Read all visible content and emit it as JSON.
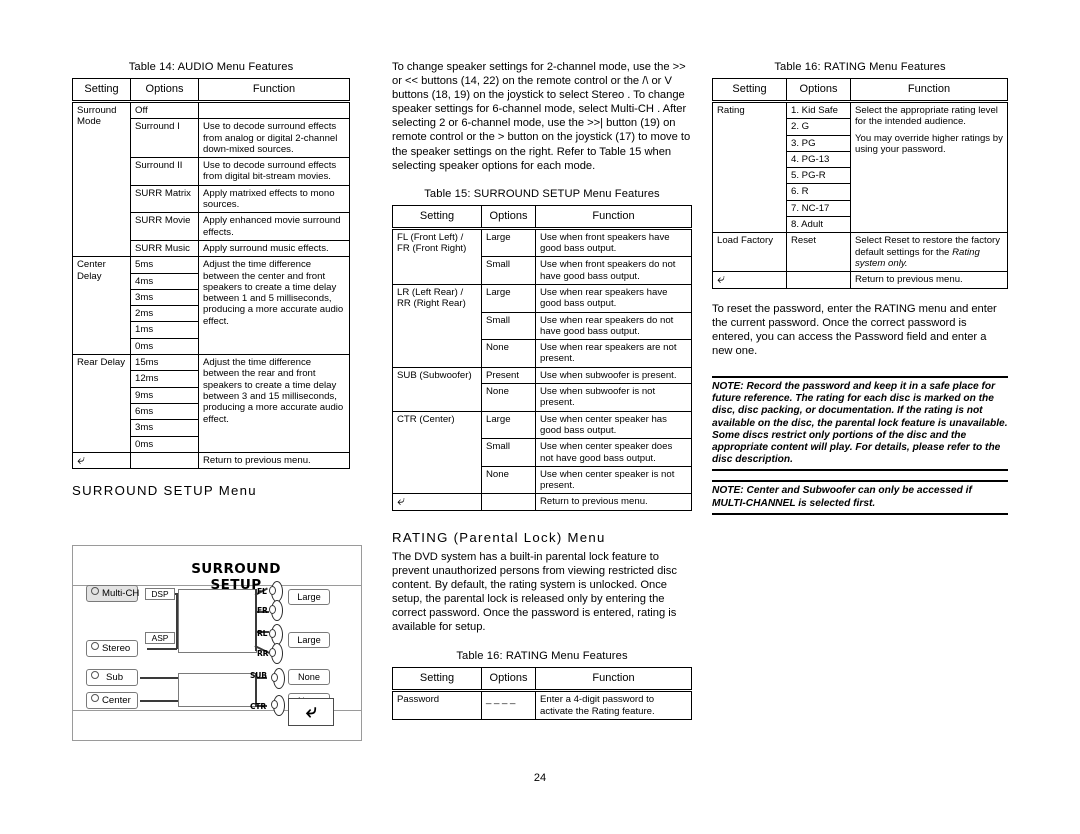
{
  "page": {
    "folio": "24"
  },
  "table14": {
    "caption": "Table 14: AUDIO Menu Features",
    "headers": [
      "Setting",
      "Options",
      "Function"
    ],
    "rows": [
      {
        "setting": "Surround Mode",
        "options": "Off",
        "function": ""
      },
      {
        "setting": "",
        "options": "Surround I",
        "function": "Use to decode surround effects from analog or digital 2-channel down-mixed sources."
      },
      {
        "setting": "",
        "options": "Surround II",
        "function": "Use to decode surround effects from digital bit-stream movies."
      },
      {
        "setting": "",
        "options": "SURR Matrix",
        "function": "Apply matrixed effects to mono sources."
      },
      {
        "setting": "",
        "options": "SURR Movie",
        "function": "Apply enhanced movie surround effects."
      },
      {
        "setting": "",
        "options": "SURR Music",
        "function": "Apply surround music effects."
      },
      {
        "setting": "Center Delay",
        "options": "5ms",
        "function": "Adjust the time difference between the center and front speakers to create a time delay between 1 and 5 milliseconds, producing a more accurate audio effect."
      },
      {
        "setting": "",
        "options": "4ms",
        "function": ""
      },
      {
        "setting": "",
        "options": "3ms",
        "function": ""
      },
      {
        "setting": "",
        "options": "2ms",
        "function": ""
      },
      {
        "setting": "",
        "options": "1ms",
        "function": ""
      },
      {
        "setting": "",
        "options": "0ms",
        "function": ""
      },
      {
        "setting": "Rear Delay",
        "options": "15ms",
        "function": "Adjust the time difference between the rear and front speakers to create a time delay between 3 and 15 milliseconds, producing a more accurate audio effect."
      },
      {
        "setting": "",
        "options": "12ms",
        "function": ""
      },
      {
        "setting": "",
        "options": "9ms",
        "function": ""
      },
      {
        "setting": "",
        "options": "6ms",
        "function": ""
      },
      {
        "setting": "",
        "options": "3ms",
        "function": ""
      },
      {
        "setting": "",
        "options": "0ms",
        "function": ""
      },
      {
        "setting": "return-icon",
        "options": "",
        "function": "Return to previous menu."
      }
    ]
  },
  "surround_heading": "SURROUND SETUP Menu",
  "osd": {
    "title": "SURROUND SETUP",
    "multi_ch": "Multi-CH",
    "stereo": "Stereo",
    "sub": "Sub",
    "center": "Center",
    "dsp": "DSP",
    "asp": "ASP",
    "fl": "FL",
    "fr": "FR",
    "rl": "RL",
    "rr": "RR",
    "sub_label": "SUB",
    "ctr_label": "CTR",
    "front_value": "Large",
    "rear_value": "Large",
    "sub_value": "None",
    "ctr_value": "None"
  },
  "mid_intro": "To change speaker settings for 2-channel mode, use the >> or << buttons (14, 22) on the remote control or the /\\ or V buttons (18, 19) on the joystick to select  Stereo . To change speaker settings for 6-channel mode, select  Multi-CH .  After selecting 2 or 6-channel mode, use the >>| button (19) on remote control or the > button on the joystick (17) to move to the speaker settings on the right. Refer to Table 15 when selecting speaker options for each mode.",
  "table15": {
    "caption": "Table 15: SURROUND SETUP Menu Features",
    "headers": [
      "Setting",
      "Options",
      "Function"
    ],
    "rows": [
      {
        "setting": "FL (Front Left) / FR (Front Right)",
        "options": "Large",
        "function": "Use when front speakers have good bass output."
      },
      {
        "setting": "",
        "options": "Small",
        "function": "Use when front speakers do not have good bass output."
      },
      {
        "setting": "LR (Left Rear) / RR (Right Rear)",
        "options": "Large",
        "function": "Use when rear speakers have good bass output."
      },
      {
        "setting": "",
        "options": "Small",
        "function": "Use when rear speakers do not have good bass output."
      },
      {
        "setting": "",
        "options": "None",
        "function": "Use when rear speakers are not present."
      },
      {
        "setting": "SUB (Subwoofer)",
        "options": "Present",
        "function": "Use when subwoofer is present."
      },
      {
        "setting": "",
        "options": "None",
        "function": "Use when subwoofer is not present."
      },
      {
        "setting": "CTR (Center)",
        "options": "Large",
        "function": "Use when center speaker has good bass output."
      },
      {
        "setting": "",
        "options": "Small",
        "function": "Use when center speaker does not have good bass output."
      },
      {
        "setting": "",
        "options": "None",
        "function": "Use when center speaker is not present."
      },
      {
        "setting": "return-icon",
        "options": "",
        "function": "Return to previous menu."
      }
    ]
  },
  "rating_heading": "RATING (Parental Lock) Menu",
  "rating_intro": "The DVD system has a built-in parental lock feature to prevent unauthorized persons from viewing restricted disc content. By default, the rating system is unlocked. Once setup, the parental lock is released only by entering the correct password. Once the password is entered, rating is available for setup.",
  "table16_password": {
    "caption": "Table 16: RATING Menu Features",
    "headers": [
      "Setting",
      "Options",
      "Function"
    ],
    "rows": [
      {
        "setting": "Password",
        "options": "_ _ _ _",
        "function": "Enter a 4-digit password to activate the  Rating  feature."
      }
    ]
  },
  "table16_rating": {
    "caption": "Table 16: RATING Menu Features",
    "headers": [
      "Setting",
      "Options",
      "Function"
    ],
    "rows": [
      {
        "setting": "Rating",
        "options": "1. Kid Safe",
        "function_line1": "Select the appropriate rating level for the intended audience.",
        "function_line2": "You may override higher ratings by using your password."
      },
      {
        "setting": "",
        "options": "2. G",
        "function": ""
      },
      {
        "setting": "",
        "options": "3. PG",
        "function": ""
      },
      {
        "setting": "",
        "options": "4. PG-13",
        "function": ""
      },
      {
        "setting": "",
        "options": "5. PG-R",
        "function": ""
      },
      {
        "setting": "",
        "options": "6. R",
        "function": ""
      },
      {
        "setting": "",
        "options": "7. NC-17",
        "function": ""
      },
      {
        "setting": "",
        "options": "8. Adult",
        "function": ""
      },
      {
        "setting": "Load Factory",
        "options": "Reset",
        "function_pre": "Select  Reset  to restore the factory default settings for the ",
        "function_italic": "Rating system only."
      },
      {
        "setting": "return-icon",
        "options": "",
        "function": "Return to previous menu."
      }
    ]
  },
  "password_reset_text": "To reset the password, enter the  RATING  menu and enter the current password. Once the correct password is entered, you can access the  Password  field and enter a new one.",
  "note1": "NOTE: Record the password and keep it in a safe place for future reference. The rating for each disc is marked on the disc, disc packing, or documentation. If the rating is not available on the disc, the parental lock feature is unavailable. Some discs restrict only portions of the disc and the appropriate content will play. For details, please refer to the disc description.",
  "note2": "NOTE: Center and Subwoofer can only be accessed if MULTI-CHANNEL is selected first."
}
